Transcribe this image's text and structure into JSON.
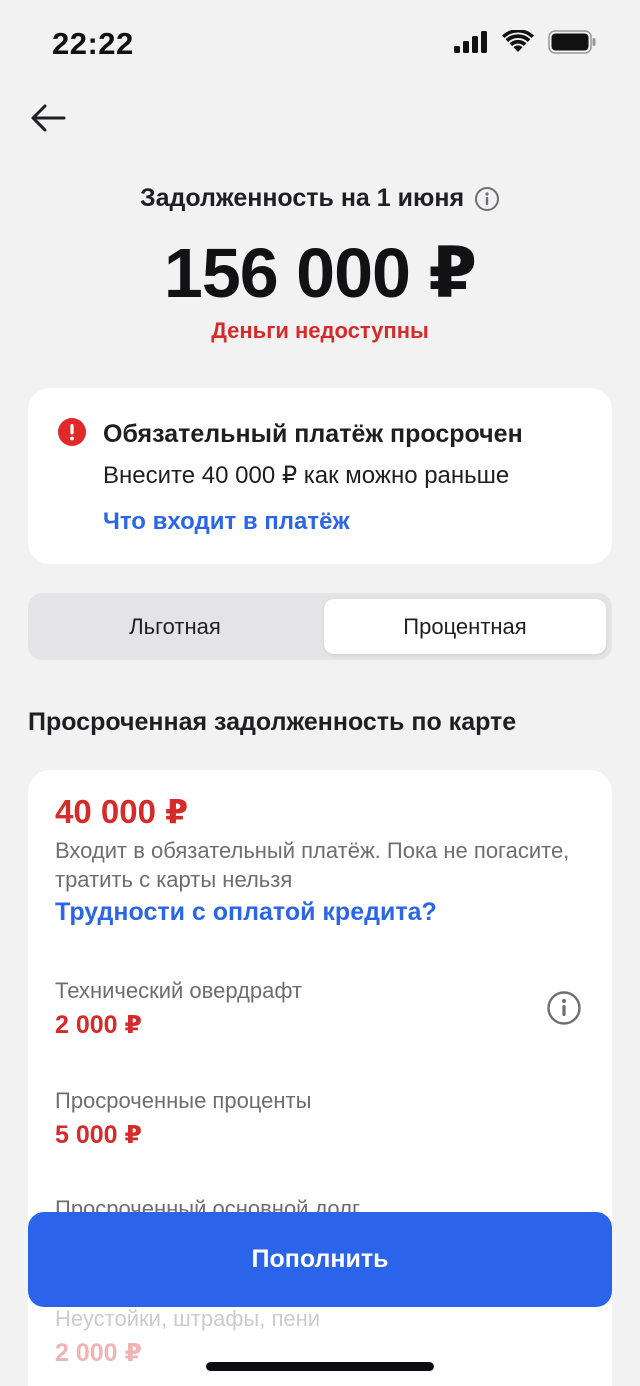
{
  "status_bar": {
    "time": "22:22",
    "icons": [
      "cellular-signal-icon",
      "wifi-icon",
      "battery-icon"
    ]
  },
  "header": {
    "back_icon": "arrow-left-icon",
    "debt_title": "Задолженность на 1 июня",
    "debt_info_icon": "info-icon",
    "debt_amount": "156 000 ₽",
    "debt_status": "Деньги недоступны"
  },
  "alert": {
    "icon": "exclamation-circle-icon",
    "title": "Обязательный платёж просрочен",
    "subtitle": "Внесите 40 000 ₽ как можно раньше",
    "link": "Что входит в платёж"
  },
  "tabs": [
    {
      "label": "Льготная",
      "selected": false
    },
    {
      "label": "Процентная",
      "selected": true
    }
  ],
  "section": {
    "title": "Просроченная задолженность по карте"
  },
  "overdue": {
    "amount": "40 000 ₽",
    "description": "Входит в обязательный платёж. Пока не погасите, тратить с карты нельзя",
    "help_link": "Трудности с оплатой кредита?",
    "items": [
      {
        "label": "Технический овердрафт",
        "value": "2 000 ₽"
      },
      {
        "label": "Просроченные проценты",
        "value": "5 000 ₽"
      },
      {
        "label": "Просроченный основной долг",
        "value": ""
      },
      {
        "label": "Неустойки, штрафы, пени",
        "value": "2 000 ₽"
      }
    ]
  },
  "actions": {
    "topup_label": "Пополнить"
  },
  "colors": {
    "accent": "#2b64eb",
    "link": "#2c66e8",
    "danger": "#d52b2b",
    "background": "#f2f2f3",
    "card": "#ffffff"
  }
}
